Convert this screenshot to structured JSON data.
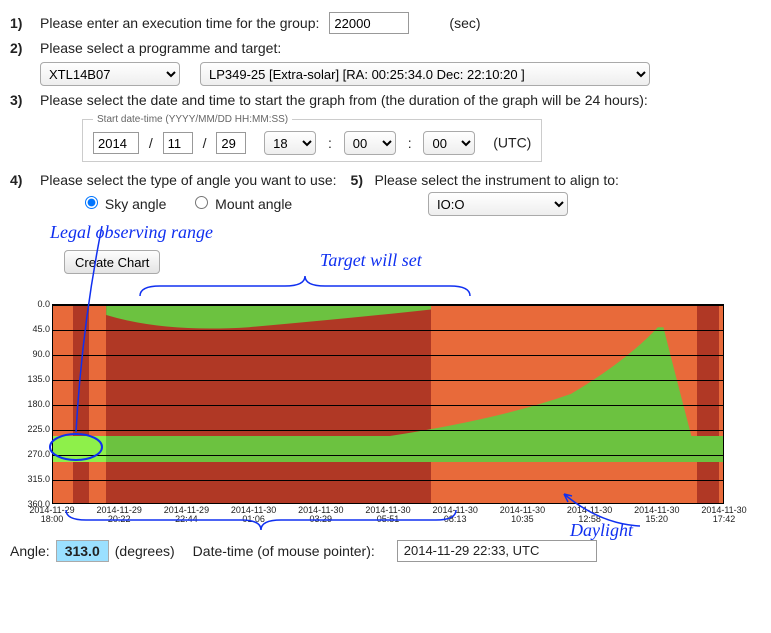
{
  "step1": {
    "num": "1)",
    "label": "Please enter an execution time for the group:",
    "value": "22000",
    "unit": "(sec)"
  },
  "step2": {
    "num": "2)",
    "label": "Please select a programme and target:",
    "programme": "XTL14B07",
    "target": "LP349-25 [Extra-solar] [RA:  00:25:34.0  Dec:  22:10:20    ]"
  },
  "step3": {
    "num": "3)",
    "label": "Please select the date and time to start the graph from (the duration of the graph will be 24 hours):",
    "legend": "Start date-time (YYYY/MM/DD HH:MM:SS)",
    "year": "2014",
    "month": "11",
    "day": "29",
    "hour": "18",
    "minute": "00",
    "second": "00",
    "tz": "(UTC)",
    "slash": "/",
    "colon": ":"
  },
  "step4": {
    "num": "4)",
    "label": "Please select the type of angle you want to use:",
    "opt_sky": "Sky angle",
    "opt_mount": "Mount angle"
  },
  "step5": {
    "num": "5)",
    "label": "Please select the instrument to align to:",
    "instrument": "IO:O"
  },
  "buttons": {
    "create": "Create Chart"
  },
  "readout": {
    "angle_label": "Angle:",
    "angle_value": "313.0",
    "degrees": "(degrees)",
    "dt_label": "Date-time (of mouse pointer):",
    "dt_value": "2014-11-29 22:33, UTC"
  },
  "annotations": {
    "legal": "Legal observing range",
    "target_set": "Target will set",
    "daylight": "Daylight"
  },
  "chart_data": {
    "type": "area",
    "ylabel": "",
    "xlabel": "",
    "ylim": [
      0,
      360
    ],
    "yticks": [
      0,
      45,
      90,
      135,
      180,
      225,
      270,
      315,
      360
    ],
    "xticks": [
      "2014-11-29 18:00",
      "2014-11-29 20:22",
      "2014-11-29 22:44",
      "2014-11-30 01:06",
      "2014-11-30 03:29",
      "2014-11-30 05:51",
      "2014-11-30 08:13",
      "2014-11-30 10:35",
      "2014-11-30 12:58",
      "2014-11-30 15:20",
      "2014-11-30 17:42"
    ],
    "daylight_ranges_hours": [
      [
        18.0,
        18.7
      ],
      [
        19.3,
        19.9
      ],
      [
        31.5,
        41.0
      ],
      [
        41.8,
        42.0
      ]
    ],
    "daylight_colors": [
      "orange",
      "orange",
      "orange",
      "orange"
    ],
    "green_polytop": [
      [
        18.0,
        0
      ],
      [
        19.2,
        0
      ],
      [
        19.5,
        20
      ],
      [
        20.3,
        40
      ],
      [
        21.8,
        50
      ],
      [
        23.5,
        48
      ],
      [
        25.0,
        42
      ],
      [
        26.5,
        35
      ],
      [
        28.5,
        25
      ],
      [
        31.5,
        12
      ],
      [
        31.5,
        360
      ]
    ],
    "green_band_lower": {
      "y_top": 230,
      "y_bot": 285,
      "start_h": 18.0,
      "end_h": 36.3,
      "end_tail": [
        [
          36.3,
          230
        ],
        [
          37.0,
          180
        ],
        [
          38.0,
          135
        ],
        [
          38.8,
          100
        ],
        [
          39.4,
          60
        ],
        [
          39.7,
          38
        ],
        [
          39.8,
          30
        ]
      ]
    },
    "note": "Hour values are hours-since-start (0..24) added to 18:00 UTC; y is degrees 0..360. Green = target visible, orange = daylight, dark red = target set/night-invalid."
  }
}
